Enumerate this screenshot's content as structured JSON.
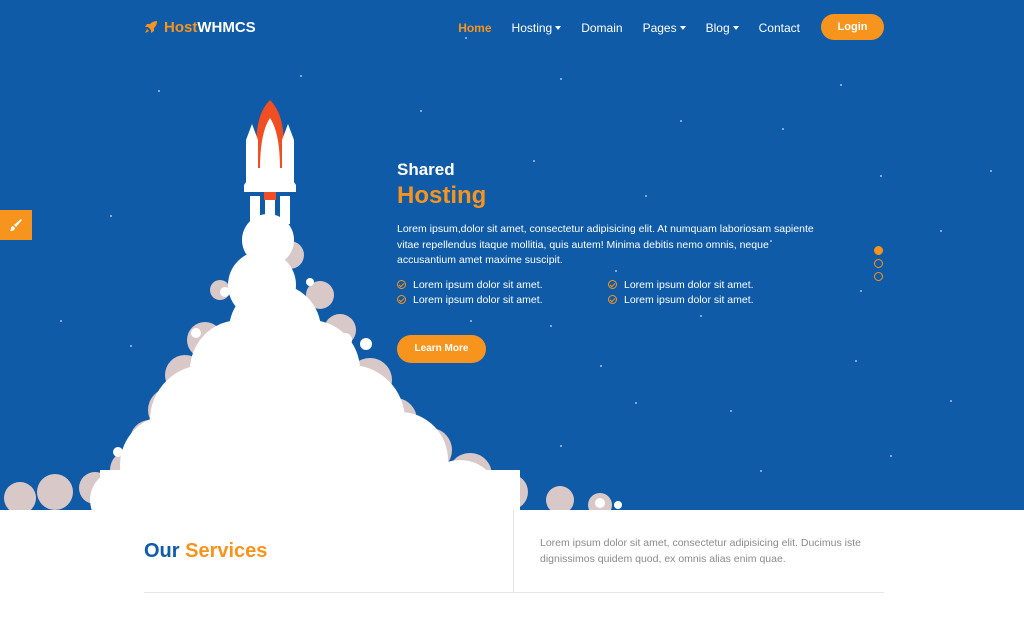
{
  "brand": {
    "logo_part1": "Host",
    "logo_part2": "WHMCS"
  },
  "nav": {
    "items": [
      {
        "label": "Home",
        "active": true,
        "dropdown": false
      },
      {
        "label": "Hosting",
        "active": false,
        "dropdown": true
      },
      {
        "label": "Domain",
        "active": false,
        "dropdown": false
      },
      {
        "label": "Pages",
        "active": false,
        "dropdown": true
      },
      {
        "label": "Blog",
        "active": false,
        "dropdown": true
      },
      {
        "label": "Contact",
        "active": false,
        "dropdown": false
      }
    ],
    "login_label": "Login"
  },
  "hero": {
    "subtitle": "Shared",
    "title": "Hosting",
    "description": "Lorem ipsum,dolor sit amet, consectetur adipisicing elit. At numquam laboriosam sapiente vitae repellendus itaque mollitia, quis autem! Minima debitis nemo omnis, neque accusantium amet maxime suscipit.",
    "features": [
      "Lorem ipsum dolor sit amet.",
      "Lorem ipsum dolor sit amet.",
      "Lorem ipsum dolor sit amet.",
      "Lorem ipsum dolor sit amet."
    ],
    "cta_label": "Learn More",
    "slide_count": 3,
    "active_slide": 1
  },
  "services": {
    "title_part1": "Our",
    "title_part2": "Services",
    "description": "Lorem ipsum dolor sit amet, consectetur adipisicing elit. Ducimus iste dignissimos quidem quod, ex omnis alias enim quae."
  },
  "colors": {
    "primary": "#0f5ba7",
    "accent": "#f7941d",
    "smoke": "#ffffff",
    "smoke_shadow": "#d9c8c8"
  },
  "icons": {
    "logo": "rocket-icon",
    "side_tab": "paintbrush-icon",
    "feature": "check-circle-icon"
  }
}
